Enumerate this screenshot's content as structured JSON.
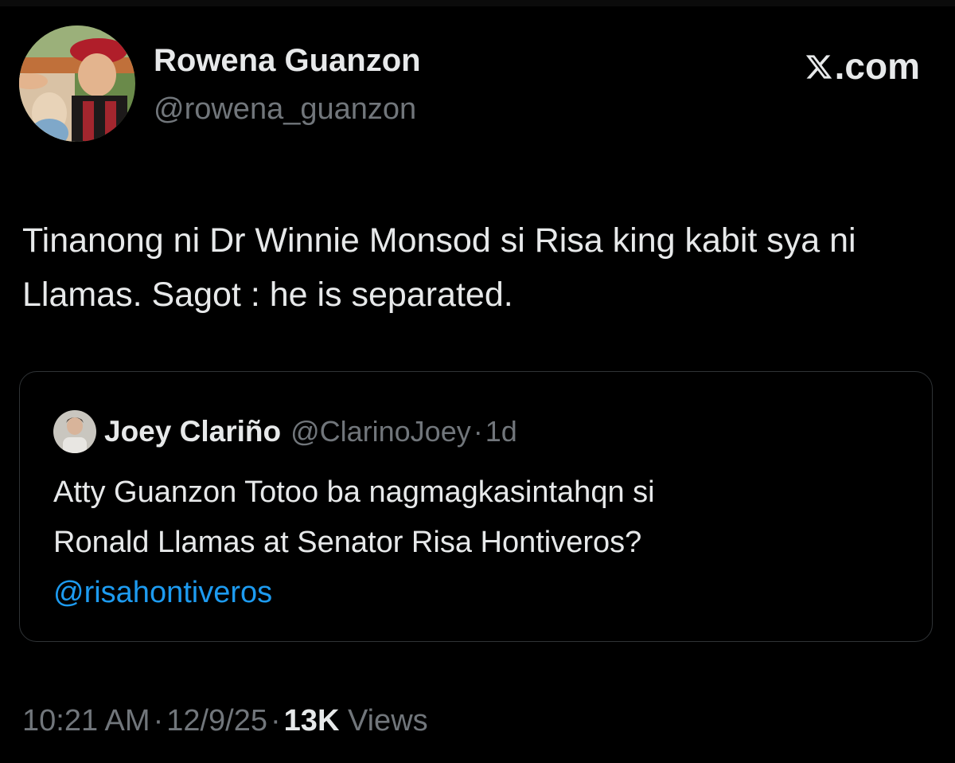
{
  "header": {
    "display_name": "Rowena Guanzon",
    "handle": "@rowena_guanzon",
    "brand_label": ".com",
    "brand_icon": "x-logo-icon"
  },
  "tweet": {
    "text": "Tinanong ni Dr Winnie Monsod si Risa king kabit sya ni Llamas. Sagot : he is separated."
  },
  "quoted_tweet": {
    "display_name": "Joey Clariño",
    "handle": "@ClarinoJoey",
    "separator": "·",
    "time": "1d",
    "line1": "Atty Guanzon Totoo ba nagmagkasintahqn si",
    "line2": "Ronald Llamas at Senator Risa Hontiveros?",
    "mention": "@risahontiveros"
  },
  "meta": {
    "time": "10:21 AM",
    "separator": "·",
    "date": "12/9/25",
    "views_count": "13K",
    "views_label": "Views"
  },
  "colors": {
    "background": "#000000",
    "text_primary": "#e7e9ea",
    "text_secondary": "#71767b",
    "link": "#1d9bf0",
    "border": "#2f3336"
  }
}
